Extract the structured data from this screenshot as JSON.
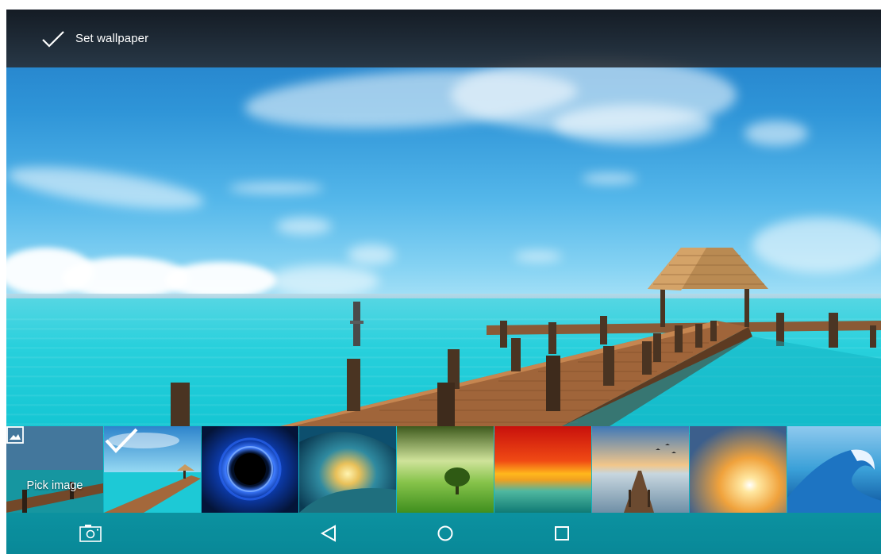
{
  "topbar": {
    "action_label": "Set wallpaper",
    "action_icon": "check-icon"
  },
  "thumbnails": {
    "pick_image_label": "Pick image",
    "pick_image_icon": "image-icon",
    "selected_index": 1,
    "items": [
      "pick-image",
      "beach-pier",
      "blue-vortex",
      "ocean-wave-sunset",
      "green-field-tree",
      "red-sunset-sea",
      "wooden-pier-sunset",
      "sunburst-clouds",
      "blue-wave"
    ]
  },
  "navbar": {
    "buttons": [
      "screenshot-icon",
      "back-icon",
      "home-icon",
      "recents-icon"
    ]
  },
  "colors": {
    "topbar_bg": "#1c2026",
    "text": "#ffffff",
    "sea": "#16c7d4",
    "sky": "#2f95d8"
  }
}
